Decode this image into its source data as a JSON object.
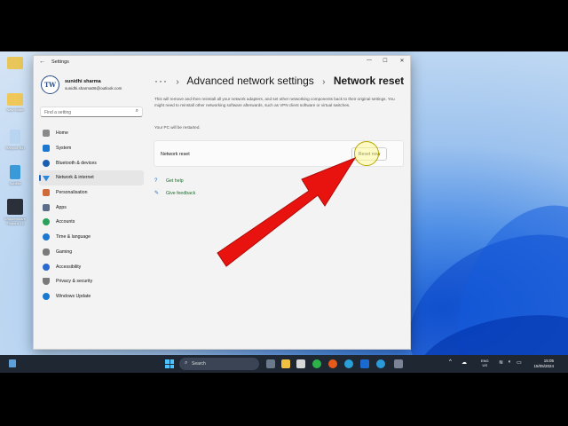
{
  "desktop": {
    "icons": [
      {
        "label": "",
        "color": "#e8c65a"
      },
      {
        "label": "New folder",
        "color": "#f0c85a"
      },
      {
        "label": "Recycle Bin",
        "color": "#b8d4f0"
      },
      {
        "label": "Subtitle",
        "color": "#3a9ad9"
      },
      {
        "label": "Wondershare Filmora 13",
        "color": "#2a2f3a"
      }
    ]
  },
  "window": {
    "title": "Settings",
    "controls": {
      "minimize": "—",
      "maximize": "☐",
      "close": "✕"
    }
  },
  "profile": {
    "initials": "TW",
    "name": "sunidhi sharma",
    "email": "sunidhi.sharma06@outlook.com"
  },
  "search": {
    "placeholder": "Find a setting"
  },
  "nav": [
    {
      "label": "Home",
      "icon": "home-icon",
      "color": "#888"
    },
    {
      "label": "System",
      "icon": "system-icon",
      "color": "#1a78d0"
    },
    {
      "label": "Bluetooth & devices",
      "icon": "bluetooth-icon",
      "color": "#1a5fb0"
    },
    {
      "label": "Network & internet",
      "icon": "network-icon",
      "color": "#2a8ae0",
      "active": true
    },
    {
      "label": "Personalisation",
      "icon": "personalisation-icon",
      "color": "#d06a3a"
    },
    {
      "label": "Apps",
      "icon": "apps-icon",
      "color": "#5a6c8a"
    },
    {
      "label": "Accounts",
      "icon": "accounts-icon",
      "color": "#2aa05a"
    },
    {
      "label": "Time & language",
      "icon": "time-language-icon",
      "color": "#1a78d0"
    },
    {
      "label": "Gaming",
      "icon": "gaming-icon",
      "color": "#7a7a7a"
    },
    {
      "label": "Accessibility",
      "icon": "accessibility-icon",
      "color": "#2a6ad0"
    },
    {
      "label": "Privacy & security",
      "icon": "privacy-icon",
      "color": "#7a7a7a"
    },
    {
      "label": "Windows Update",
      "icon": "windows-update-icon",
      "color": "#1a78d0"
    }
  ],
  "breadcrumb": {
    "dots": "···",
    "parent": "Advanced network settings",
    "current": "Network reset"
  },
  "description": "This will remove and then reinstall all your network adapters, and set other networking components back to their original settings. You might need to reinstall other networking software afterwards, such as VPN client software or virtual switches.",
  "restart_note": "Your PC will be restarted.",
  "reset_card": {
    "label": "Network reset",
    "button": "Reset now"
  },
  "links": [
    {
      "label": "Get help",
      "icon": "help-icon"
    },
    {
      "label": "Give feedback",
      "icon": "feedback-icon"
    }
  ],
  "annotation": {
    "arrow_color": "#e8130f"
  },
  "taskbar": {
    "search_label": "Search",
    "lang_line1": "ENG",
    "lang_line2": "US",
    "time": "15:05",
    "date": "15/05/2024"
  }
}
